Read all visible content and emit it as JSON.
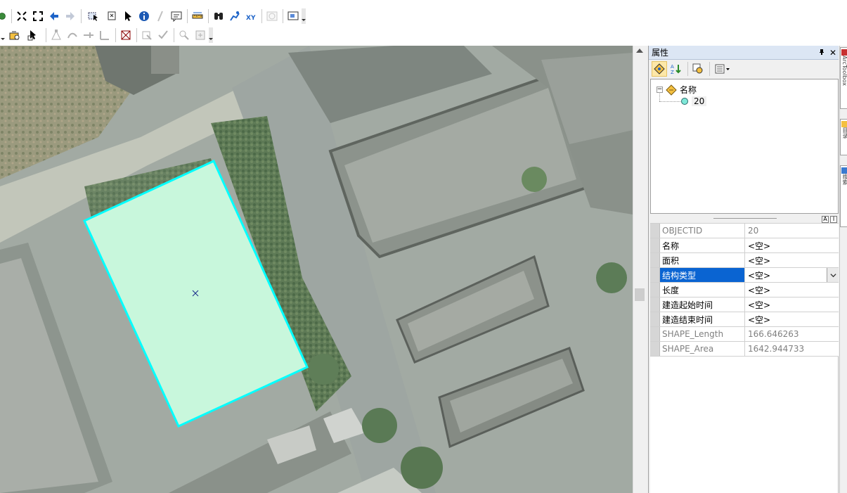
{
  "panel": {
    "title": "属性",
    "pin": "ᵖ",
    "close": "✕",
    "tree": {
      "root_label": "名称",
      "child_label": "20"
    },
    "fields": [
      {
        "name": "OBJECTID",
        "value": "20",
        "readonly": true
      },
      {
        "name": "名称",
        "value": "<空>",
        "readonly": false
      },
      {
        "name": "面积",
        "value": "<空>",
        "readonly": false
      },
      {
        "name": "结构类型",
        "value": "<空>",
        "readonly": false,
        "selected": true
      },
      {
        "name": "长度",
        "value": "<空>",
        "readonly": false
      },
      {
        "name": "建造起始时间",
        "value": "<空>",
        "readonly": false
      },
      {
        "name": "建造结束时间",
        "value": "<空>",
        "readonly": false
      },
      {
        "name": "SHAPE_Length",
        "value": "166.646263",
        "readonly": true
      },
      {
        "name": "SHAPE_Area",
        "value": "1642.944733",
        "readonly": true
      }
    ]
  },
  "side_tabs": [
    "ArcToolbox",
    "目录",
    "搜索"
  ],
  "colors": {
    "selection_outline": "#00ffff",
    "selection_fill": "#c8f7dc",
    "selected_row": "#0a64d2"
  }
}
